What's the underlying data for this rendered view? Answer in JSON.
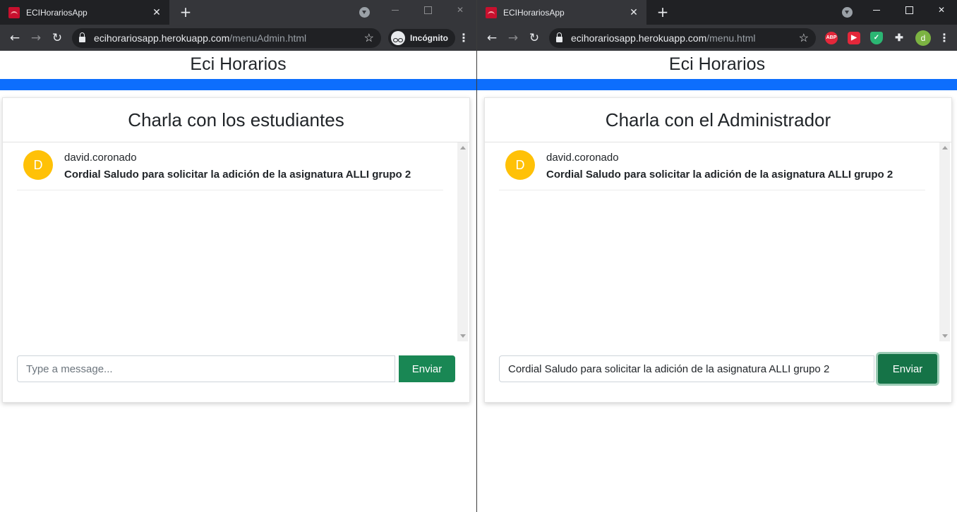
{
  "left_window": {
    "tab_title": "ECIHorariosApp",
    "url_host": "ecihorariosapp.herokuapp.com",
    "url_path": "/menuAdmin.html",
    "incognito_label": "Incógnito",
    "page_title": "Eci Horarios",
    "card_title": "Charla con los estudiantes",
    "messages": [
      {
        "avatar": "D",
        "user": "david.coronado",
        "text": "Cordial Saludo para solicitar la adición de la asignatura ALLI grupo 2"
      }
    ],
    "input_value": "",
    "input_placeholder": "Type a message...",
    "send_label": "Enviar"
  },
  "right_window": {
    "tab_title": "ECIHorariosApp",
    "url_host": "ecihorariosapp.herokuapp.com",
    "url_path": "/menu.html",
    "profile_initial": "d",
    "extensions": [
      "ABP",
      "▶",
      "✓",
      "✚"
    ],
    "page_title": "Eci Horarios",
    "card_title": "Charla con el Administrador",
    "messages": [
      {
        "avatar": "D",
        "user": "david.coronado",
        "text": "Cordial Saludo para solicitar la adición de la asignatura ALLI grupo 2"
      }
    ],
    "input_value": "Cordial Saludo para solicitar la adición de la asignatura ALLI grupo 2",
    "send_label": "Enviar"
  },
  "colors": {
    "accent_blue": "#0d6efd",
    "send_green": "#198754",
    "avatar_yellow": "#ffc107"
  }
}
